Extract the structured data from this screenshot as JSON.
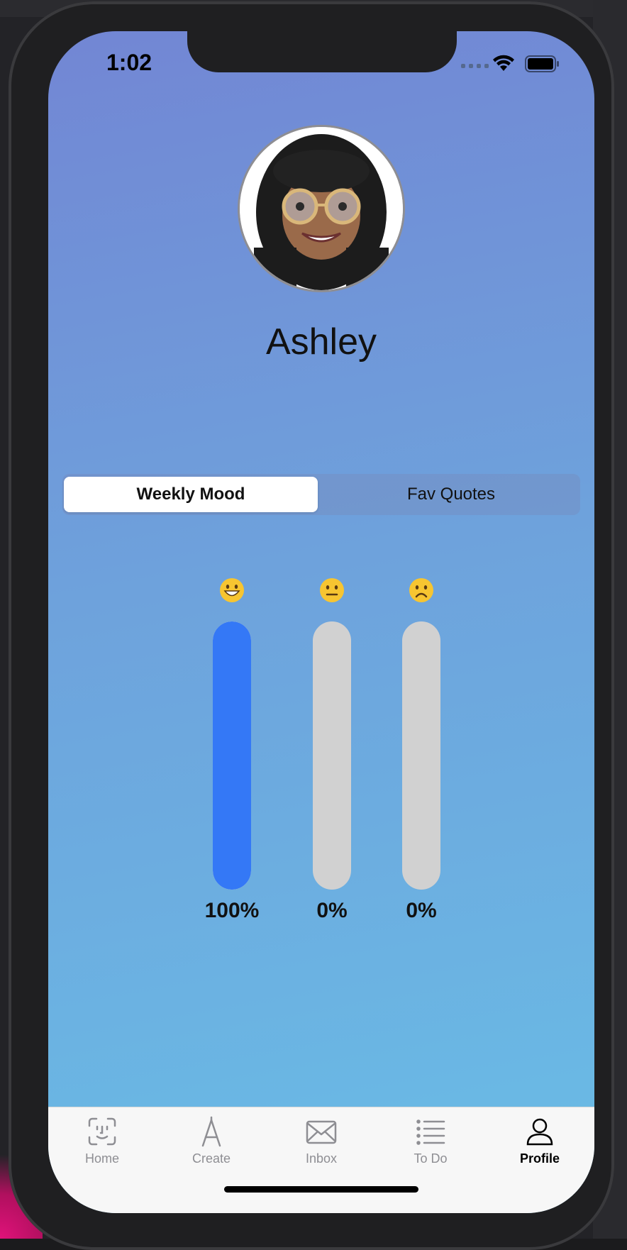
{
  "status_bar": {
    "time": "1:02"
  },
  "profile": {
    "name": "Ashley"
  },
  "segments": [
    {
      "label": "Weekly Mood",
      "selected": true
    },
    {
      "label": "Fav Quotes",
      "selected": false
    }
  ],
  "mood": [
    {
      "emoji": "grinning-face-icon",
      "fraction": 1.0,
      "percent_label": "100%"
    },
    {
      "emoji": "neutral-face-icon",
      "fraction": 0.0,
      "percent_label": "0%"
    },
    {
      "emoji": "frowning-face-icon",
      "fraction": 0.0,
      "percent_label": "0%"
    }
  ],
  "colors": {
    "accent": "#3478f6",
    "bar_empty": "#d1d1d1",
    "gradient_top": "#7286d4",
    "gradient_bottom": "#69bde6"
  },
  "tabbar": {
    "items": [
      {
        "label": "Home",
        "icon": "face-id-icon",
        "selected": false
      },
      {
        "label": "Create",
        "icon": "compass-icon",
        "selected": false
      },
      {
        "label": "Inbox",
        "icon": "envelope-icon",
        "selected": false
      },
      {
        "label": "To Do",
        "icon": "list-icon",
        "selected": false
      },
      {
        "label": "Profile",
        "icon": "person-icon",
        "selected": true
      }
    ]
  }
}
